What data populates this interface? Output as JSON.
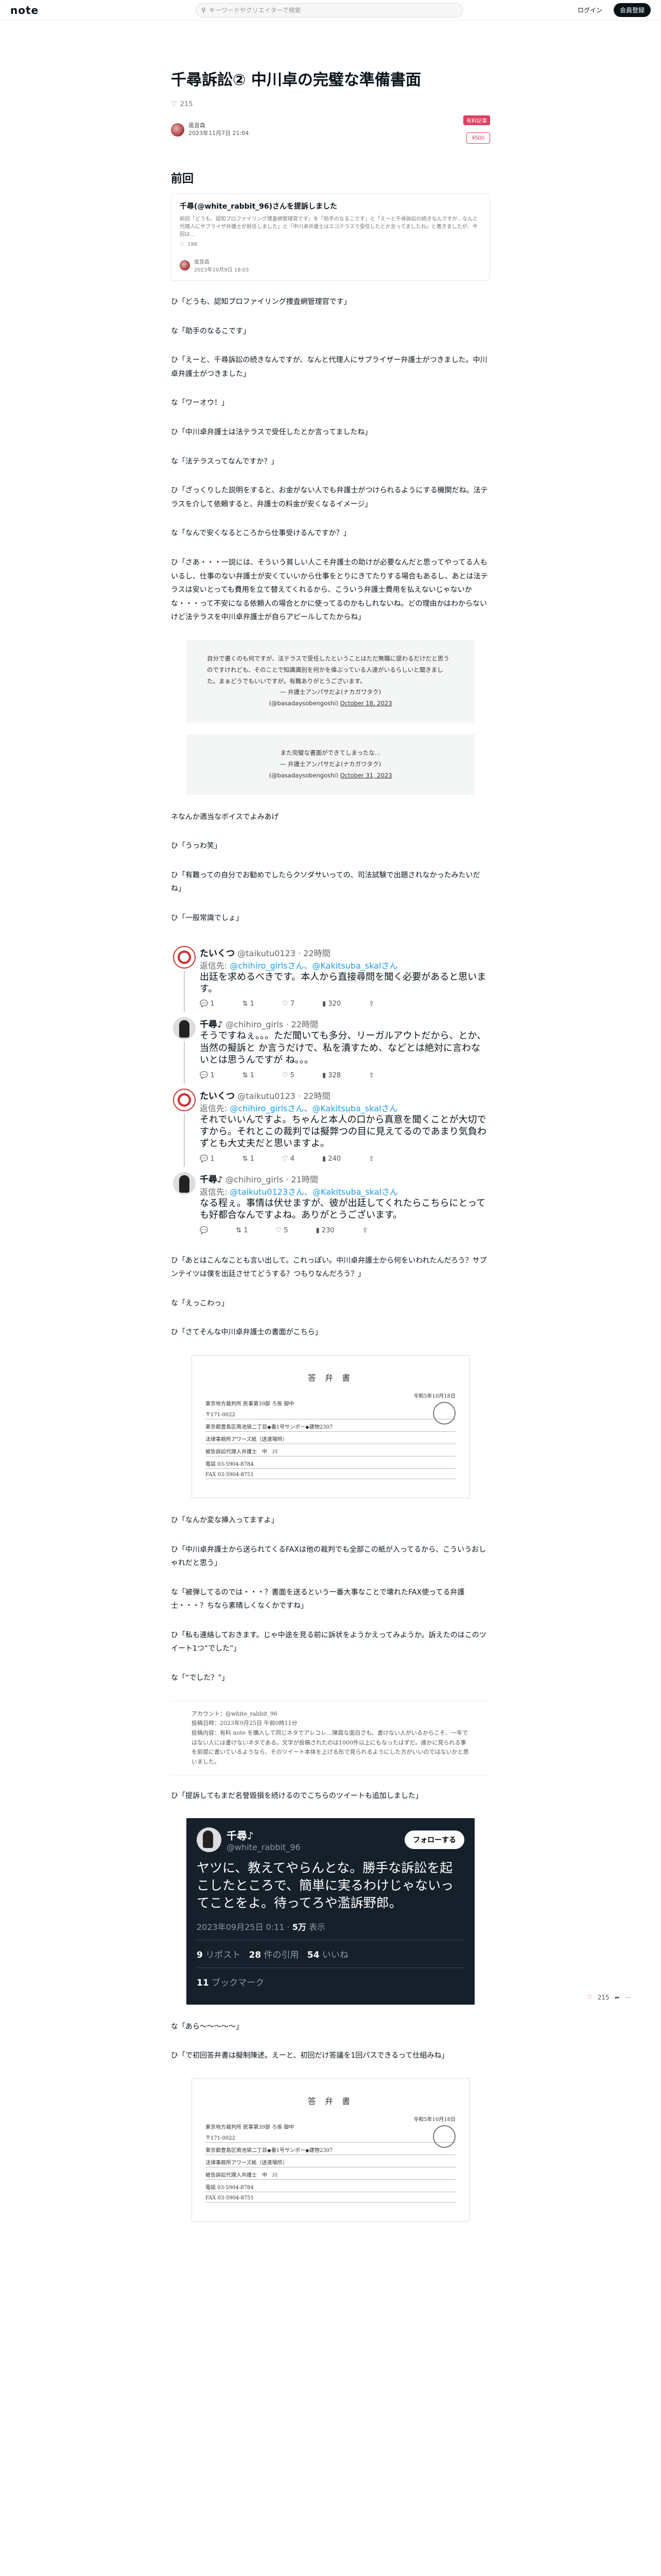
{
  "header": {
    "logo": "note",
    "search_placeholder": "キーワードやクリエイターで検索",
    "login": "ログイン",
    "signup": "会員登録"
  },
  "article": {
    "title": "千尋訴訟② 中川卓の完璧な準備書面",
    "likes": "215",
    "author": "風音森",
    "date": "2023年11月7日 21:04",
    "badge": "有料記事",
    "price": "¥500"
  },
  "section_title": "前回",
  "embed": {
    "title": "千尋(@white_rabbit_96)さんを提訴しました",
    "excerpt": "前回「どうも、認知プロファイリング捜査網管理官です」を「助手のなるこです」と「えーと千尋訴訟の続きなんですが…なんと代理人にサプライザ弁護士が就任しました」と「中川卓弁護士はエコテラスで受任したとか言ってましたね」と書きましたが、今回は…",
    "likes": "196",
    "author": "風音森",
    "date": "2023年10月9日 18:03"
  },
  "paras": {
    "p1": "ひ「どうも、認知プロファイリング捜査網管理官です」",
    "p2": "な「助手のなるこです」",
    "p3": "ひ「えーと、千尋訴訟の続きなんですが、なんと代理人にサプライザー弁護士がつきました。中川卓弁護士がつきました」",
    "p4": "な「ワーオウ！」",
    "p5": "ひ「中川卓弁護士は法テラスで受任したとか言ってましたね」",
    "p6": "な「法テラスってなんですか？」",
    "p7": "ひ「ざっくりした説明をすると、お金がない人でも弁護士がつけられるようにする機関だね。法テラスを介して依頼すると、弁護士の料金が安くなるイメージ」",
    "p8": "な「なんで安くなるところから仕事受けるんですか？」",
    "p9": "ひ「さあ・・・一説には、そういう貧しい人こそ弁護士の助けが必要なんだと思ってやってる人もいるし、仕事のない弁護士が安くていいから仕事をとりにきてたりする場合もあるし、あとは法テラスは安いとっても費用を立て替えてくれるから、こういう弁護士費用を払えないじゃないかな・・・って不安になる依頼人の場合とかに使ってるのかもしれないね。どの理由かはわからないけど法テラスを中川卓弁護士が自らアピールしてたからね」",
    "p10": "ネなんか適当なボイスでよみあげ",
    "p11": "ひ「うっわ笑」",
    "p12": "ひ「有難っての自分でお勧めでしたらクソダサいっての、司法試験で出題されなかったみたいだね」",
    "p13": "ひ「一般常識でしょ」",
    "p14": "ひ「あとはこんなことも言い出して。これっぽい。中川卓弁護士から何をいわれたんだろう？サプンテイツは僕を出廷させてどうする？つもりなんだろう？」",
    "p15": "な「えっこわっ」",
    "p16": "ひ「さてそんな中川卓弁護士の書面がこちら」",
    "p17": "ひ「なんか変な挿入ってますよ」",
    "p18": "ひ「中川卓弁護士から送られてくるFAXは他の裁判でも全部この紙が入ってるから、こういうおしゃれだと思う」",
    "p19": "な「被弾してるのでは・・・？書面を送るという一番大事なことで壊れたFAX使ってる弁護士・・・？ちなら素晴しくなくかですね」",
    "p20": "ひ「私も連絡しておきます。じゃ中途を見る前に訴状をようかえってみようか。訴えたのはこのツイート1つ“でした”」",
    "p21": "な「“でした？”」",
    "p22": "ひ「提訴してもまだ名誉毀損を続けるのでこちらのツイートも追加しました」",
    "p23": "な「あら〜〜〜〜〜」",
    "p24": "ひ「で初回答弁書は擬制陳述。えーと、初回だけ答議を1回パスできるって仕組みね」"
  },
  "quotes": {
    "q1_text": "自分で書くのも何ですが、法テラスで受任したということはただ無職に提わるだけだと思うのですけれども、そのことで知識識別を何かを偉ぶっている人達がいるらしいと聞きました。まぁどうでもいいですが。有難ありがとうございます。",
    "q1_author": "— 弁護士アンパサだよ(ナカガワタク)",
    "q1_handle": "(@basadaysobengoshi)",
    "q1_date": "October 18, 2023",
    "q2_text": "また完璧な書面ができてしまったな…",
    "q2_author": "— 弁護士アンパサだよ(ナカガワタク)",
    "q2_handle": "(@basadaysobengoshi)",
    "q2_date": "October 31, 2023"
  },
  "tweets": [
    {
      "name": "たいくつ",
      "handle": "@taikutu0123 · 22時間",
      "reply_to": "返信先: ",
      "reply_link": "@chihiro_girlsさん、@Kakitsuba_skalさん",
      "text": "出廷を求めるべきです。本人から直接尋問を聞く必要があると思います。",
      "replies": "1",
      "retweets": "1",
      "likes": "7",
      "views": "320"
    },
    {
      "name": "千尋♪",
      "handle": "@chihiro_girls · 22時間",
      "reply_to": "",
      "reply_link": "",
      "text": "そうですねぇ。。。ただ聞いても多分、リーガルアウトだから、とか、当然の擬訴と か言うだけで、私を潰すため、などとは絶対に言わないとは思うんですが ね。。。",
      "replies": "1",
      "retweets": "1",
      "likes": "5",
      "views": "328"
    },
    {
      "name": "たいくつ",
      "handle": "@taikutu0123 · 22時間",
      "reply_to": "返信先: ",
      "reply_link": "@chihiro_girlsさん、@Kakitsuba_skalさん",
      "text": "それでいいんですよ。ちゃんと本人の口から真意を聞くことが大切ですから。それとこの裁判では擬弊つの目に見えてるのであまり気負わずとも大丈夫だと思いますよ。",
      "replies": "1",
      "retweets": "1",
      "likes": "4",
      "views": "240"
    },
    {
      "name": "千尋♪",
      "handle": "@chihiro_girls · 21時間",
      "reply_to": "返信先: ",
      "reply_link": "@taikutu0123さん、@Kakitsuba_skalさん",
      "text": "なる程ぇ。事情は伏せますが、彼が出廷してくれたらこちらにとっても好都合なんですよね。ありがとうございます。",
      "replies": "",
      "retweets": "1",
      "likes": "5",
      "views": "230"
    }
  ],
  "doc": {
    "title": "答 弁 書",
    "date": "令和5年10月18日",
    "court": "東京地方裁判所 民事第39部 ろ係 御中",
    "lines": [
      "〒171-0022",
      "東京都豊島区南池袋二丁目◆番1号サンポー◆建物2307",
      "法律事務所アワーズ紙（送達場所）",
      "被告訴訟代理人弁護士　中　川",
      "電話 03-5904-8784",
      "FAX 03-5904-8751"
    ]
  },
  "text_block": {
    "line1": "アカウント：@white_rabbit_96",
    "line2": "投稿日時：2023年9月25日 午前0時11分",
    "line3": "投稿内容：有料 note を購入して同じネタでアレコレ…陳腐な面白さも、書けない人がいるからこそ、一年ではない人には書けないネタである。文字が投稿されたのは1000件以上にもなったはずだ。誰かに見られる事を前提に書いているようなら、そのツイート本体を上げる形で見られるようにした方がいいのではないかと思いました。"
  },
  "dark_tweet": {
    "name": "千尋♪",
    "handle": "@white_rabbit_96",
    "follow": "フォローする",
    "text": "ヤツに、教えてやらんとな。勝手な訴訟を起こしたところで、簡単に実るわけじゃないってことをよ。待ってろや濫訴野郎。",
    "time": "2023年09月25日 0:11 · ",
    "views": "5万",
    "views_label": "表示",
    "reposts": "9",
    "reposts_label": "リポスト",
    "quotes": "28",
    "quotes_label": "件の引用",
    "likes": "54",
    "likes_label": "いいね",
    "bookmarks": "11",
    "bookmarks_label": "ブックマーク"
  },
  "side": {
    "likes": "215"
  }
}
